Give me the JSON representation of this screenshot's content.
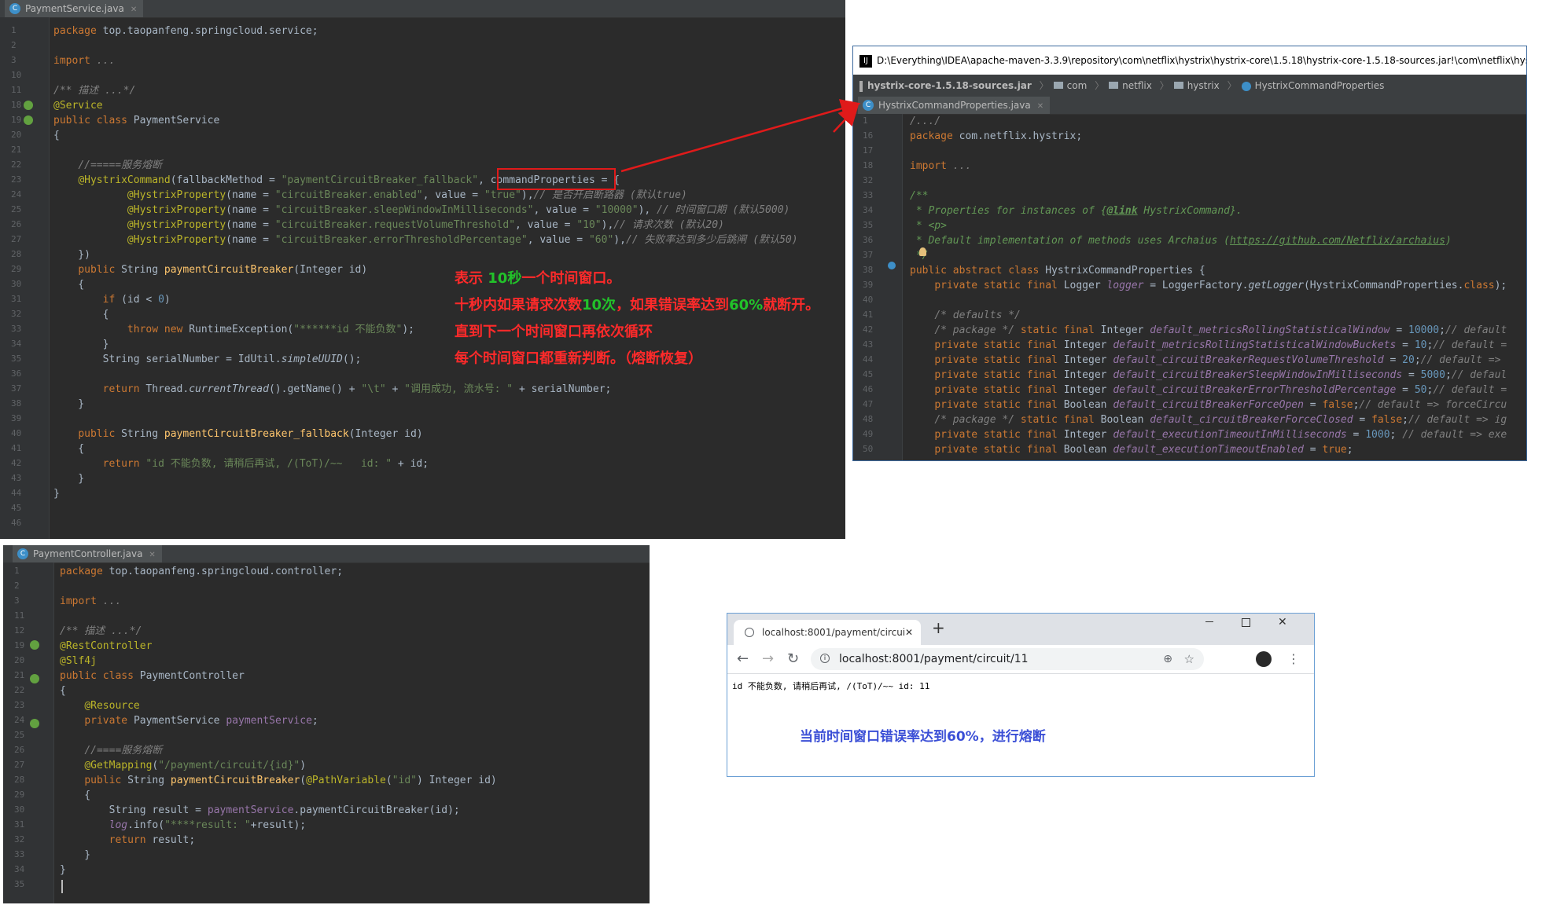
{
  "panel1": {
    "tab": "PaymentService.java",
    "lines": [
      {
        "n": "1",
        "c": "<span class='kw'>package </span>top.taopanfeng.springcloud.service;"
      },
      {
        "n": "2",
        "c": ""
      },
      {
        "n": "3",
        "c": "<span class='kw'>import </span><span class='cm'>...</span>"
      },
      {
        "n": "10",
        "c": ""
      },
      {
        "n": "11",
        "c": "<span class='cm'>/** 描述 ...*/</span>"
      },
      {
        "n": "18",
        "c": "<span class='an'>@Service</span>"
      },
      {
        "n": "19",
        "c": "<span class='kw'>public class </span>PaymentService"
      },
      {
        "n": "20",
        "c": "{"
      },
      {
        "n": "21",
        "c": ""
      },
      {
        "n": "22",
        "c": "    <span class='cm'>//=====服务熔断</span>"
      },
      {
        "n": "23",
        "c": "    <span class='an'>@HystrixCommand</span>(fallbackMethod = <span class='str'>\"paymentCircuitBreaker_fallback\"</span>, commandProperties = {"
      },
      {
        "n": "24",
        "c": "            <span class='an'>@HystrixProperty</span>(name = <span class='str'>\"circuitBreaker.enabled\"</span>, value = <span class='str'>\"true\"</span>),<span class='cm'>// 是否开启断路器 (默认true)</span>"
      },
      {
        "n": "25",
        "c": "            <span class='an'>@HystrixProperty</span>(name = <span class='str'>\"circuitBreaker.sleepWindowInMilliseconds\"</span>, value = <span class='str'>\"10000\"</span>), <span class='cm'>// 时间窗口期 (默认5000)</span>"
      },
      {
        "n": "26",
        "c": "            <span class='an'>@HystrixProperty</span>(name = <span class='str'>\"circuitBreaker.requestVolumeThreshold\"</span>, value = <span class='str'>\"10\"</span>),<span class='cm'>// 请求次数 (默认20)</span>"
      },
      {
        "n": "27",
        "c": "            <span class='an'>@HystrixProperty</span>(name = <span class='str'>\"circuitBreaker.errorThresholdPercentage\"</span>, value = <span class='str'>\"60\"</span>),<span class='cm'>// 失败率达到多少后跳闸 (默认50)</span>"
      },
      {
        "n": "28",
        "c": "    })"
      },
      {
        "n": "29",
        "c": "    <span class='kw'>public </span>String <span class='fn'>paymentCircuitBreaker</span>(Integer id)"
      },
      {
        "n": "30",
        "c": "    {"
      },
      {
        "n": "31",
        "c": "        <span class='kw'>if </span>(id &lt; <span class='num'>0</span>)"
      },
      {
        "n": "32",
        "c": "        {"
      },
      {
        "n": "33",
        "c": "            <span class='kw'>throw new </span>RuntimeException(<span class='str'>\"******id 不能负数\"</span>);"
      },
      {
        "n": "34",
        "c": "        }"
      },
      {
        "n": "35",
        "c": "        String serialNumber = IdUtil.<span class='it'>simpleUUID</span>();"
      },
      {
        "n": "36",
        "c": ""
      },
      {
        "n": "37",
        "c": "        <span class='kw'>return </span>Thread.<span class='it'>currentThread</span>().getName() + <span class='str'>\"\\t\"</span> + <span class='str'>\"调用成功, 流水号: \"</span> + serialNumber;"
      },
      {
        "n": "38",
        "c": "    }"
      },
      {
        "n": "39",
        "c": ""
      },
      {
        "n": "40",
        "c": "    <span class='kw'>public </span>String <span class='fn'>paymentCircuitBreaker_fallback</span>(Integer id)"
      },
      {
        "n": "41",
        "c": "    {"
      },
      {
        "n": "42",
        "c": "        <span class='kw'>return </span><span class='str'>\"id 不能负数, 请稍后再试, /(ToT)/~~   id: \"</span> + id;"
      },
      {
        "n": "43",
        "c": "    }"
      },
      {
        "n": "44",
        "c": "}"
      },
      {
        "n": "45",
        "c": ""
      },
      {
        "n": "46",
        "c": ""
      }
    ]
  },
  "notes": [
    {
      "html": "表示 <span class='grn'>10秒</span>一个时间窗口。"
    },
    {
      "html": "十秒内如果请求次数<span class='grn'>10次</span>，如果错误率达到<span class='grn'>60%</span>就断开。"
    },
    {
      "html": "直到下一个时间窗口再依次循环"
    },
    {
      "html": "每个时间窗口都重新判断。（熔断恢复）"
    }
  ],
  "panel2": {
    "title": "D:\\Everything\\IDEA\\apache-maven-3.3.9\\repository\\com\\netflix\\hystrix\\hystrix-core\\1.5.18\\hystrix-core-1.5.18-sources.jar!\\com\\netflix\\hystrix\\H",
    "crumbs": [
      "hystrix-core-1.5.18-sources.jar",
      "com",
      "netflix",
      "hystrix",
      "HystrixCommandProperties"
    ],
    "tab": "HystrixCommandProperties.java",
    "lines": [
      {
        "n": "1",
        "c": "<span class='cm'>/.../</span>"
      },
      {
        "n": "16",
        "c": "<span class='kw'>package </span>com.netflix.hystrix;"
      },
      {
        "n": "17",
        "c": ""
      },
      {
        "n": "18",
        "c": "<span class='kw'>import </span><span class='cm'>...</span>"
      },
      {
        "n": "32",
        "c": ""
      },
      {
        "n": "33",
        "c": "<span class='doc'>/**</span>"
      },
      {
        "n": "34",
        "c": "<span class='doc'> * Properties for instances of {<b><u>@link</u></b> HystrixCommand}.</span>"
      },
      {
        "n": "35",
        "c": "<span class='doc'> * &lt;p&gt;</span>"
      },
      {
        "n": "36",
        "c": "<span class='doc'> * Default implementation of methods uses Archaius (<u>https://github.com/Netflix/archaius</u>)</span>"
      },
      {
        "n": "37",
        "c": "<span class='doc'> */</span>"
      },
      {
        "n": "38",
        "c": "<span class='kw'>public abstract class </span>HystrixCommandProperties {"
      },
      {
        "n": "39",
        "c": "    <span class='kw'>private static final </span>Logger <span class='fldi'>logger</span> = LoggerFactory.<span class='it'>getLogger</span>(HystrixCommandProperties.<span class='kw'>class</span>);"
      },
      {
        "n": "40",
        "c": ""
      },
      {
        "n": "41",
        "c": "    <span class='cm'>/* defaults */</span>"
      },
      {
        "n": "42",
        "c": "    <span class='cm'>/* package */</span> <span class='kw'>static final </span>Integer <span class='fldi'>default_metricsRollingStatisticalWindow</span> = <span class='num'>10000</span>;<span class='cm'>// default</span>"
      },
      {
        "n": "43",
        "c": "    <span class='kw'>private static final </span>Integer <span class='fldi'>default_metricsRollingStatisticalWindowBuckets</span> = <span class='num'>10</span>;<span class='cm'>// default =</span>"
      },
      {
        "n": "44",
        "c": "    <span class='kw'>private static final </span>Integer <span class='fldi'>default_circuitBreakerRequestVolumeThreshold</span> = <span class='num'>20</span>;<span class='cm'>// default =&gt;</span>"
      },
      {
        "n": "45",
        "c": "    <span class='kw'>private static final </span>Integer <span class='fldi'>default_circuitBreakerSleepWindowInMilliseconds</span> = <span class='num'>5000</span>;<span class='cm'>// defaul</span>"
      },
      {
        "n": "46",
        "c": "    <span class='kw'>private static final </span>Integer <span class='fldi'>default_circuitBreakerErrorThresholdPercentage</span> = <span class='num'>50</span>;<span class='cm'>// default =</span>"
      },
      {
        "n": "47",
        "c": "    <span class='kw'>private static final </span>Boolean <span class='fldi'>default_circuitBreakerForceOpen</span> = <span class='kw'>false</span>;<span class='cm'>// default =&gt; forceCircu</span>"
      },
      {
        "n": "48",
        "c": "    <span class='cm'>/* package */</span> <span class='kw'>static final </span>Boolean <span class='fldi'>default_circuitBreakerForceClosed</span> = <span class='kw'>false</span>;<span class='cm'>// default =&gt; ig</span>"
      },
      {
        "n": "49",
        "c": "    <span class='kw'>private static final </span>Integer <span class='fldi'>default_executionTimeoutInMilliseconds</span> = <span class='num'>1000</span>; <span class='cm'>// default =&gt; exe</span>"
      },
      {
        "n": "50",
        "c": "    <span class='kw'>private static final </span>Boolean <span class='fldi'>default_executionTimeoutEnabled</span> = <span class='kw'>true</span>;"
      }
    ]
  },
  "panel3": {
    "tab": "PaymentController.java",
    "lines": [
      {
        "n": "1",
        "c": "<span class='kw'>package </span>top.taopanfeng.springcloud.controller;"
      },
      {
        "n": "2",
        "c": ""
      },
      {
        "n": "3",
        "c": "<span class='kw'>import </span><span class='cm'>...</span>"
      },
      {
        "n": "11",
        "c": ""
      },
      {
        "n": "12",
        "c": "<span class='cm'>/** 描述 ...*/</span>"
      },
      {
        "n": "19",
        "c": "<span class='an'>@RestController</span>"
      },
      {
        "n": "20",
        "c": "<span class='an'>@Slf4j</span>"
      },
      {
        "n": "21",
        "c": "<span class='kw'>public class </span>PaymentController"
      },
      {
        "n": "22",
        "c": "{"
      },
      {
        "n": "23",
        "c": "    <span class='an'>@Resource</span>"
      },
      {
        "n": "24",
        "c": "    <span class='kw'>private </span>PaymentService <span class='fld'>paymentService</span>;"
      },
      {
        "n": "25",
        "c": ""
      },
      {
        "n": "26",
        "c": "    <span class='cm'>//====服务熔断</span>"
      },
      {
        "n": "27",
        "c": "    <span class='an'>@GetMapping</span>(<span class='str'>\"/payment/circuit/{id}\"</span>)"
      },
      {
        "n": "28",
        "c": "    <span class='kw'>public </span>String <span class='fn'>paymentCircuitBreaker</span>(<span class='an'>@PathVariable</span>(<span class='str'>\"id\"</span>) Integer id)"
      },
      {
        "n": "29",
        "c": "    {"
      },
      {
        "n": "30",
        "c": "        String result = <span class='fld'>paymentService</span>.paymentCircuitBreaker(id);"
      },
      {
        "n": "31",
        "c": "        <span class='fldi'>log</span>.info(<span class='str'>\"****result: \"</span>+result);"
      },
      {
        "n": "32",
        "c": "        <span class='kw'>return </span>result;"
      },
      {
        "n": "33",
        "c": "    }"
      },
      {
        "n": "34",
        "c": "}"
      },
      {
        "n": "35",
        "c": ""
      }
    ]
  },
  "browser": {
    "tab_title": "localhost:8001/payment/circui",
    "url": "localhost:8001/payment/circuit/11",
    "body_text": "id 不能负数, 请稍后再试, /(ToT)/~~   id: 11",
    "annotation": "当前时间窗口错误率达到60%，进行熔断"
  },
  "colors": {
    "ide_bg": "#2b2b2b",
    "keyword": "#cc7832",
    "annotation": "#bbb529",
    "string": "#6a8759",
    "note_red": "#ff2a2a",
    "note_green": "#22c22a",
    "browser_note": "#3b4fd6"
  }
}
